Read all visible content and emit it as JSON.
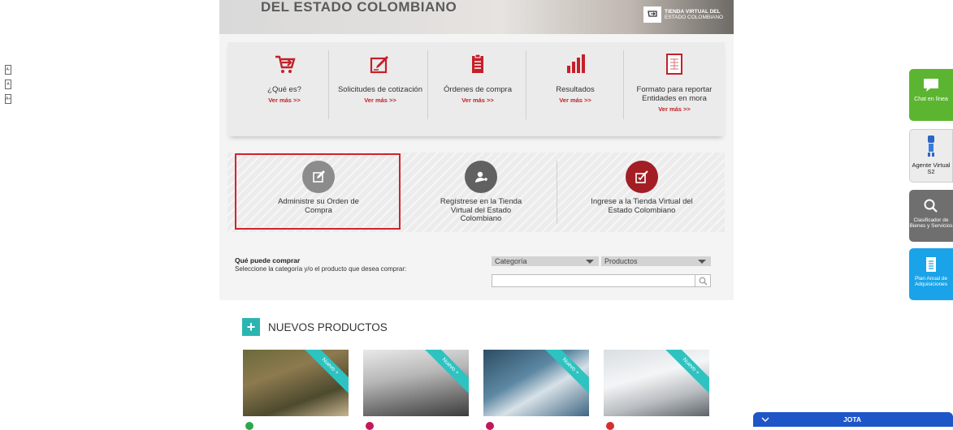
{
  "banner": {
    "title": "DEL ESTADO COLOMBIANO",
    "logo_line1": "TIENDA VIRTUAL DEL",
    "logo_line2": "ESTADO COLOMBIANO"
  },
  "services": [
    {
      "label": "¿Qué es?",
      "more": "Ver más >>",
      "icon": "cart-arrow-icon"
    },
    {
      "label": "Solicitudes de cotización",
      "more": "Ver más >>",
      "icon": "edit-form-icon"
    },
    {
      "label": "Órdenes de compra",
      "more": "Ver más >>",
      "icon": "clipboard-icon"
    },
    {
      "label": "Resultados",
      "more": "Ver más >>",
      "icon": "bar-chart-icon"
    },
    {
      "label": "Formato para reportar Entidades en mora",
      "more": "Ver más >>",
      "icon": "spreadsheet-icon"
    }
  ],
  "actions": [
    {
      "label": "Administre su Orden de Compra",
      "icon": "edit-square-icon",
      "color": "#8c8c8c"
    },
    {
      "label": "Regístrese en la Tienda Virtual del Estado Colombiano",
      "icon": "add-user-icon",
      "color": "#616161"
    },
    {
      "label": "Ingrese a la Tienda Virtual del Estado Colombiano",
      "icon": "checkbox-pen-icon",
      "color": "#a31d24"
    }
  ],
  "buy": {
    "heading": "Qué puede comprar",
    "subtitle": "Seleccione la categoría y/o el producto que desea comprar:",
    "category_select": "Categoría",
    "product_select": "Productos",
    "search_value": ""
  },
  "new_products": {
    "title": "NUEVOS PRODUCTOS",
    "badge": "Nuevo +",
    "dot_colors": [
      "#2ea84a",
      "#c2185b",
      "#c2185b",
      "#d32f2f"
    ]
  },
  "side_tabs": [
    {
      "label": "Chat en línea",
      "color": "#5cb531",
      "icon": "chat-icon"
    },
    {
      "label": "Agente Virtual S2",
      "color": "#ececec",
      "icon": "robot-agent-icon"
    },
    {
      "label": "Clasificador de Bienes y Servicios",
      "color": "#6f6f6f",
      "icon": "search-icon"
    },
    {
      "label": "Plan Anual de Adquisiciones",
      "color": "#1aa3e8",
      "icon": "document-icon"
    }
  ],
  "chat_bar": {
    "name": "JOTA"
  },
  "mini_tabs": [
    "A-",
    "A",
    "A+"
  ]
}
